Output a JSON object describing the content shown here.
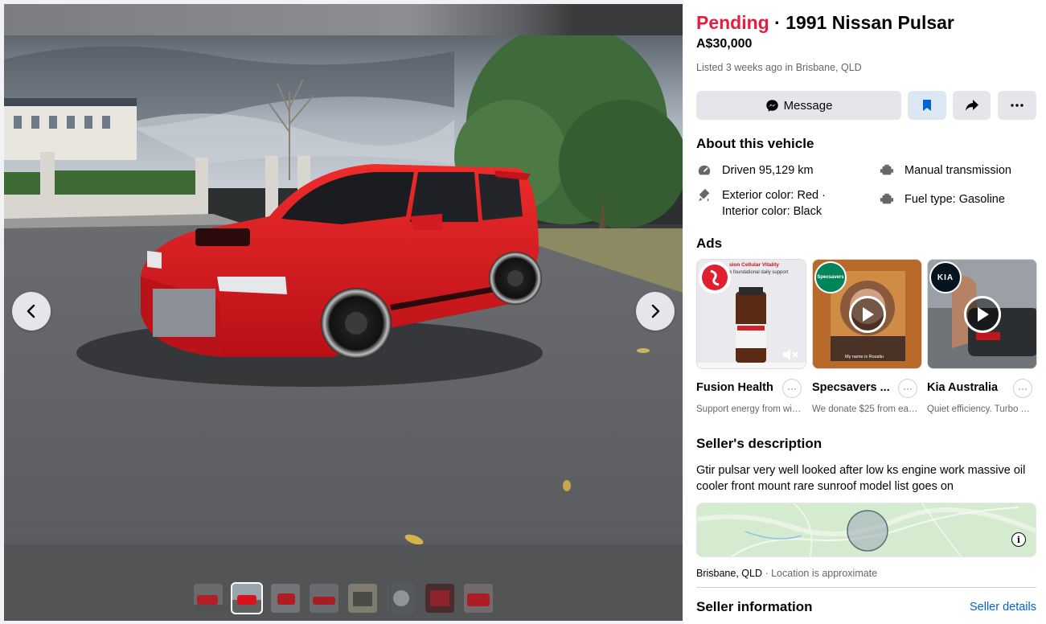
{
  "listing": {
    "status": "Pending",
    "separator": "·",
    "title": "1991 Nissan Pulsar",
    "price": "A$30,000",
    "listed": "Listed 3 weeks ago in Brisbane, QLD"
  },
  "actions": {
    "message_label": "Message",
    "icons": [
      "messenger-icon",
      "bookmark-icon",
      "share-icon",
      "more-icon"
    ]
  },
  "about": {
    "heading": "About this vehicle",
    "specs": [
      {
        "icon": "speedometer-icon",
        "text": "Driven 95,129 km"
      },
      {
        "icon": "transmission-icon",
        "text": "Manual transmission"
      },
      {
        "icon": "paint-icon",
        "line1": "Exterior color: Red ·",
        "line2": "Interior color: Black"
      },
      {
        "icon": "fuel-icon",
        "text": "Fuel type: Gasoline"
      }
    ]
  },
  "ads": {
    "heading": "Ads",
    "items": [
      {
        "name": "Fusion Health",
        "desc": "Support energy from wi…",
        "more": "···",
        "img_line1": "sion Cellular Vitality",
        "img_line2": "e foundational daily support"
      },
      {
        "name": "Specsavers ...",
        "desc": "We donate $25 from ea…",
        "more": "···",
        "logo_text": "Specsavers",
        "caption": "My name is Rozaliu"
      },
      {
        "name": "Kia Australia",
        "desc": "Quiet efficiency. Turbo …",
        "more": "···",
        "logo_text": "KIA"
      }
    ]
  },
  "seller_description": {
    "heading": "Seller's description",
    "text": "Gtir pulsar very well looked after low ks engine work massive oil cooler front mount rare sunroof model list goes on"
  },
  "location": {
    "city": "Brisbane, QLD",
    "note": " · Location is approximate",
    "info_label": "i"
  },
  "seller_info": {
    "heading": "Seller information",
    "link": "Seller details"
  },
  "thumbnails": {
    "count": 8,
    "active_index": 1
  },
  "colors": {
    "pending": "#e41e3f",
    "link": "#0064d1",
    "button_bg": "#e4e6eb",
    "save_bg": "#dbe7f2",
    "car_red": "#d7141e"
  }
}
